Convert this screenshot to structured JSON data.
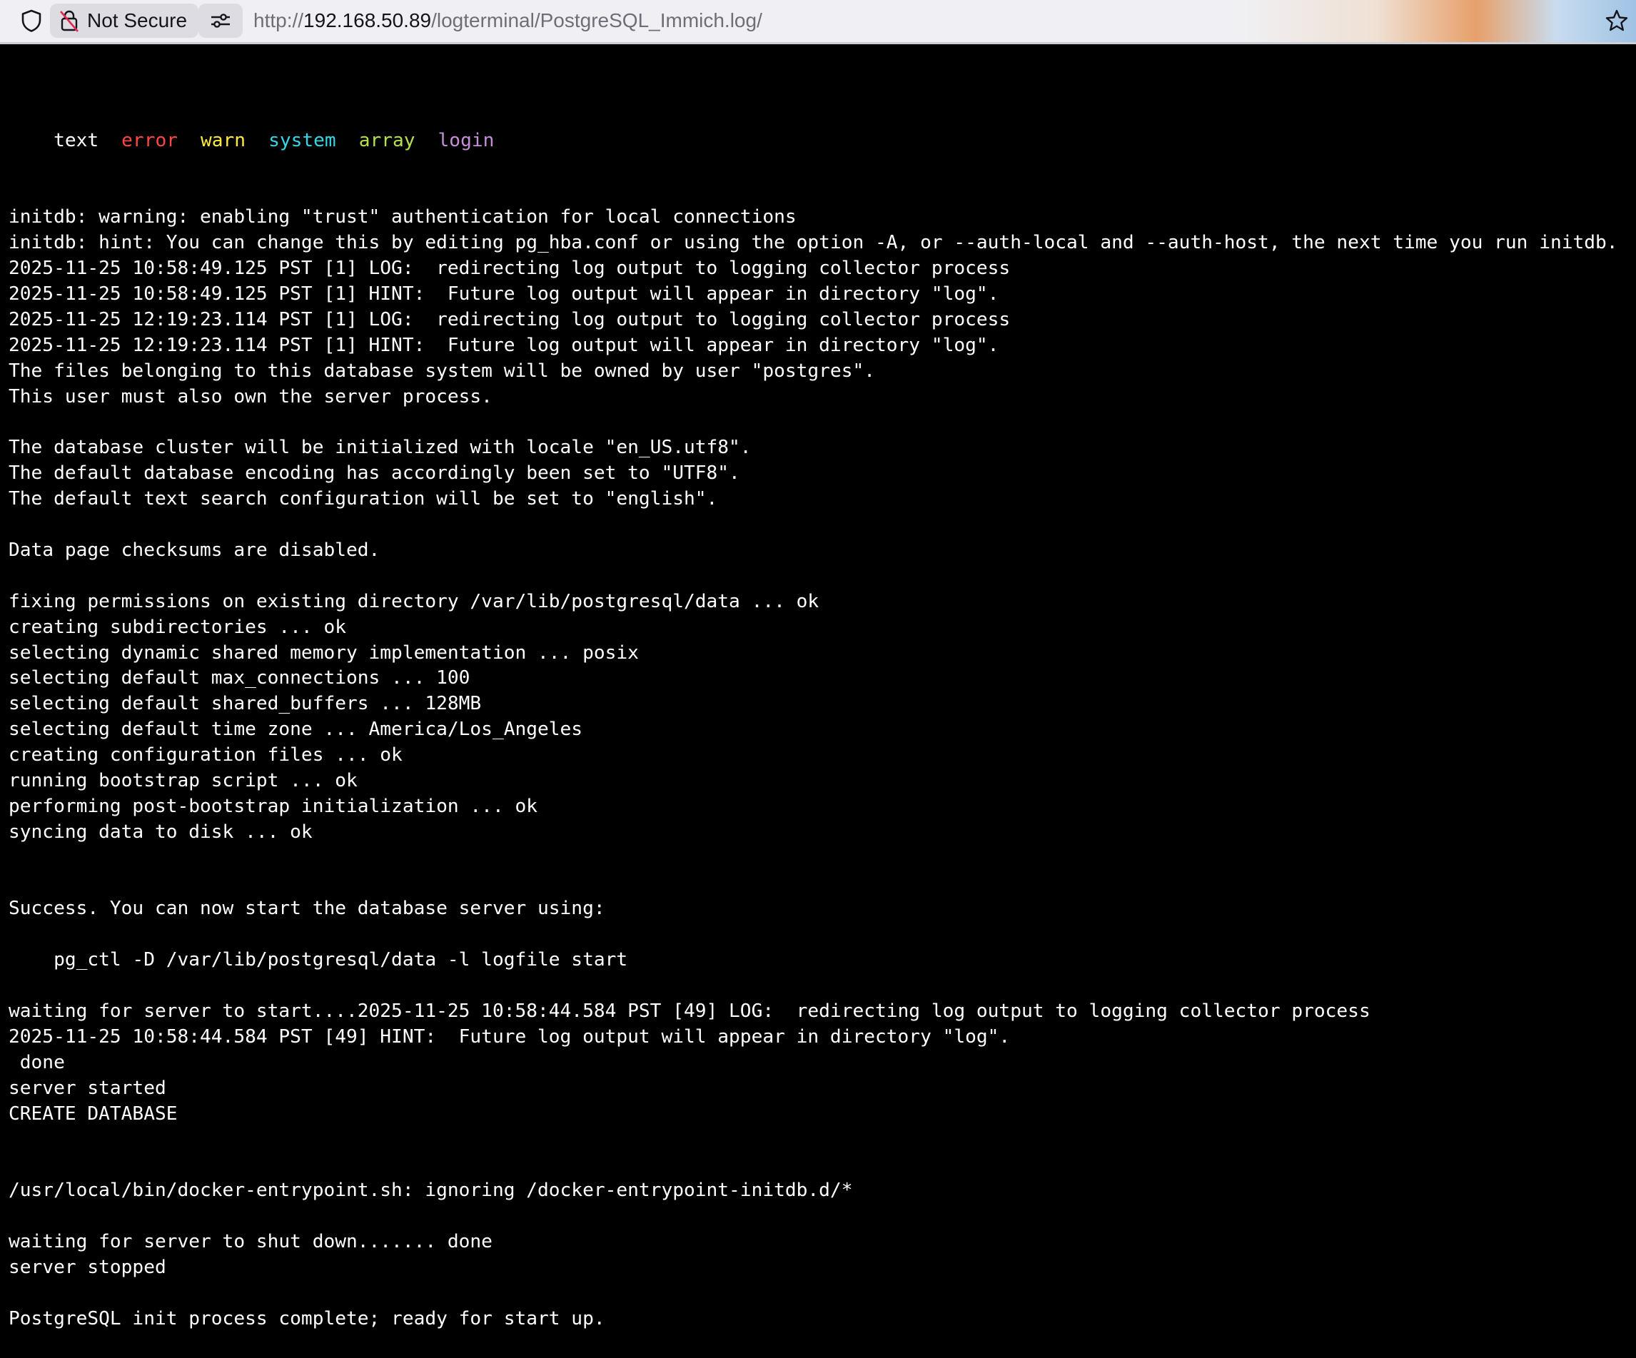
{
  "browser": {
    "security_label": "Not Secure",
    "url_prefix": "http://",
    "url_host": "192.168.50.89",
    "url_path": "/logterminal/PostgreSQL_Immich.log/"
  },
  "filters": [
    "text",
    "error",
    "warn",
    "system",
    "array",
    "login"
  ],
  "log_lines": [
    "",
    "initdb: warning: enabling \"trust\" authentication for local connections",
    "initdb: hint: You can change this by editing pg_hba.conf or using the option -A, or --auth-local and --auth-host, the next time you run initdb.",
    "2025-11-25 10:58:49.125 PST [1] LOG:  redirecting log output to logging collector process",
    "2025-11-25 10:58:49.125 PST [1] HINT:  Future log output will appear in directory \"log\".",
    "2025-11-25 12:19:23.114 PST [1] LOG:  redirecting log output to logging collector process",
    "2025-11-25 12:19:23.114 PST [1] HINT:  Future log output will appear in directory \"log\".",
    "The files belonging to this database system will be owned by user \"postgres\".",
    "This user must also own the server process.",
    "",
    "The database cluster will be initialized with locale \"en_US.utf8\".",
    "The default database encoding has accordingly been set to \"UTF8\".",
    "The default text search configuration will be set to \"english\".",
    "",
    "Data page checksums are disabled.",
    "",
    "fixing permissions on existing directory /var/lib/postgresql/data ... ok",
    "creating subdirectories ... ok",
    "selecting dynamic shared memory implementation ... posix",
    "selecting default max_connections ... 100",
    "selecting default shared_buffers ... 128MB",
    "selecting default time zone ... America/Los_Angeles",
    "creating configuration files ... ok",
    "running bootstrap script ... ok",
    "performing post-bootstrap initialization ... ok",
    "syncing data to disk ... ok",
    "",
    "",
    "Success. You can now start the database server using:",
    "",
    "    pg_ctl -D /var/lib/postgresql/data -l logfile start",
    "",
    "waiting for server to start....2025-11-25 10:58:44.584 PST [49] LOG:  redirecting log output to logging collector process",
    "2025-11-25 10:58:44.584 PST [49] HINT:  Future log output will appear in directory \"log\".",
    " done",
    "server started",
    "CREATE DATABASE",
    "",
    "",
    "/usr/local/bin/docker-entrypoint.sh: ignoring /docker-entrypoint-initdb.d/*",
    "",
    "waiting for server to shut down....... done",
    "server stopped",
    "",
    "PostgreSQL init process complete; ready for start up."
  ]
}
